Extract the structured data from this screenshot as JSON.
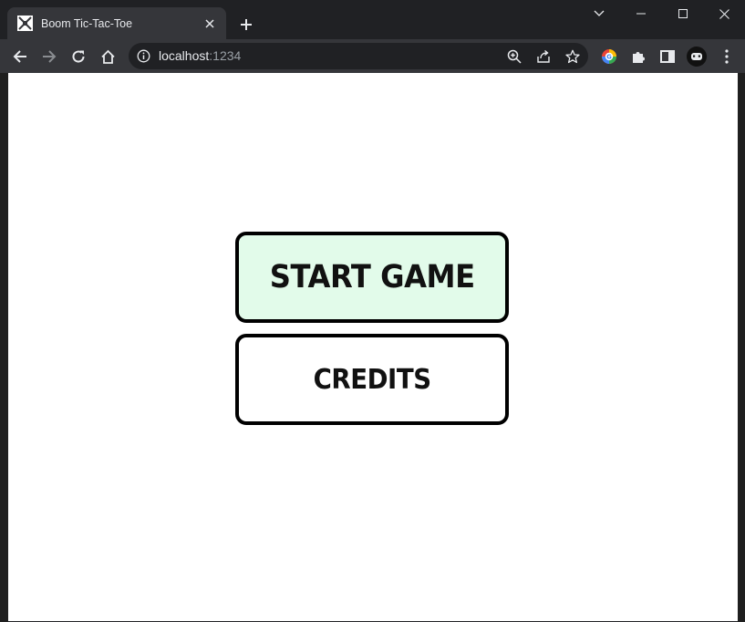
{
  "browser": {
    "tab": {
      "title": "Boom Tic-Tac-Toe",
      "favicon": "game-favicon"
    },
    "address": {
      "host": "localhost",
      "port": ":1234"
    },
    "colors": {
      "chrome_dark": "#202124",
      "toolbar": "#35363a",
      "text": "#e8eaed",
      "dim_text": "#9aa0a6"
    }
  },
  "page": {
    "background": "#ffffff",
    "menu": {
      "start_label": "START GAME",
      "start_bg": "#e2fbea",
      "credits_label": "CREDITS",
      "credits_bg": "#ffffff"
    }
  }
}
